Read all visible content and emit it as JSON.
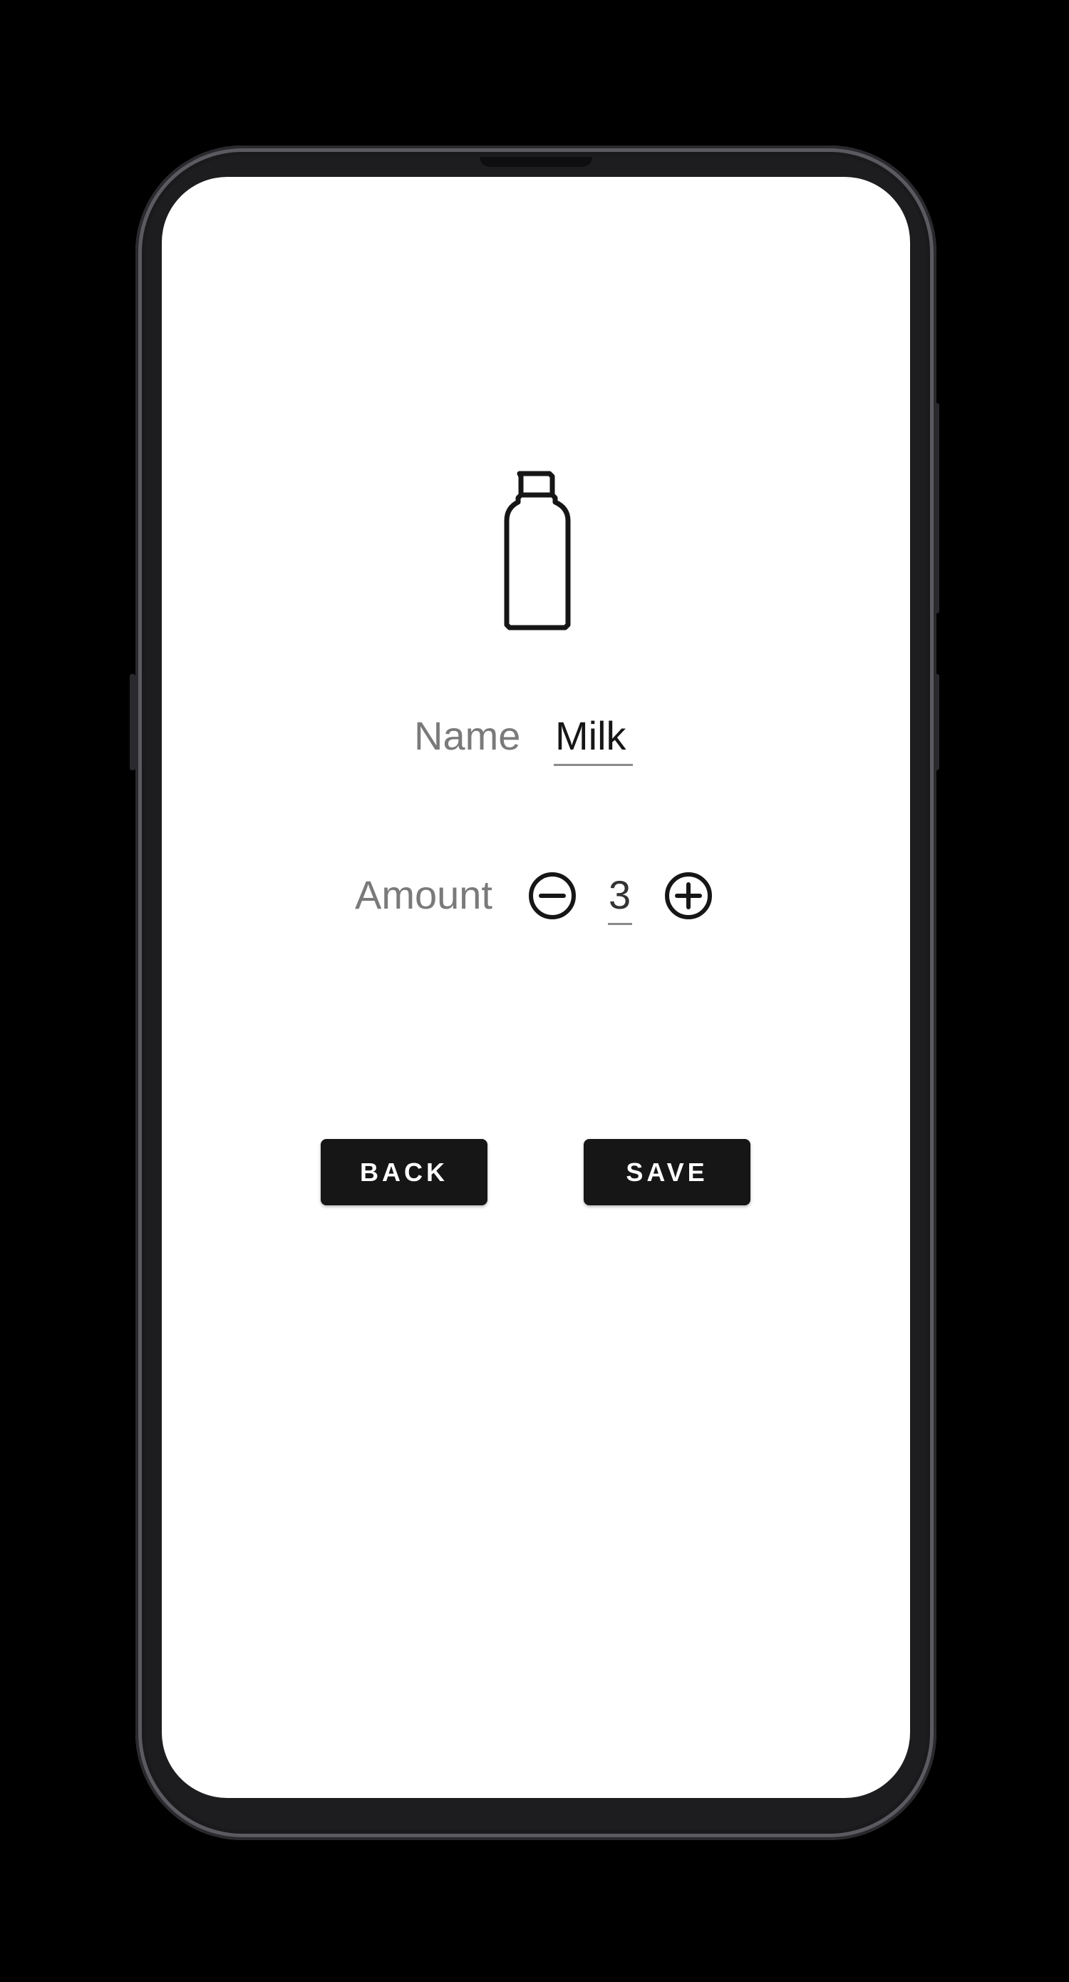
{
  "item_icon": "milk-bottle-icon",
  "form": {
    "name_label": "Name",
    "name_value": "Milk",
    "amount_label": "Amount",
    "amount_value": "3",
    "decrement_icon": "minus-circle-icon",
    "increment_icon": "plus-circle-icon"
  },
  "actions": {
    "back_label": "BACK",
    "save_label": "SAVE"
  },
  "colors": {
    "button_bg": "#161616",
    "label_text": "#7a7a7a",
    "value_text": "#161616"
  }
}
